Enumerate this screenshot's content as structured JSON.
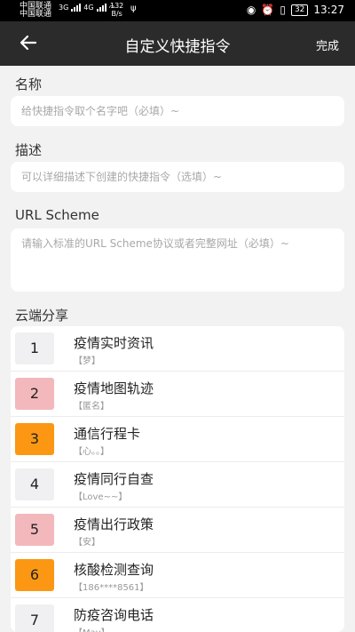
{
  "status_bar": {
    "carrier1": "中国联通",
    "carrier2": "中国联通",
    "net1": "3G",
    "net2": "4G",
    "speed_value": "132",
    "speed_unit": "B/s",
    "battery": "32",
    "time": "13:27"
  },
  "appbar": {
    "title": "自定义快捷指令",
    "done_label": "完成"
  },
  "form": {
    "name_label": "名称",
    "name_placeholder": "给快捷指令取个名字吧（必填）~",
    "name_value": "",
    "desc_label": "描述",
    "desc_placeholder": "可以详细描述下创建的快捷指令（选填）~",
    "desc_value": "",
    "url_label": "URL Scheme",
    "url_placeholder": "请输入标准的URL Scheme协议或者完整网址（必填）~",
    "url_value": ""
  },
  "cloud": {
    "section_label": "云端分享",
    "items": [
      {
        "rank": "1",
        "name": "疫情实时资讯",
        "author": "【梦】",
        "badge_color": "#f0f0f2"
      },
      {
        "rank": "2",
        "name": "疫情地图轨迹",
        "author": "【匿名】",
        "badge_color": "#f3b8bb"
      },
      {
        "rank": "3",
        "name": "通信行程卡",
        "author": "【心。。】",
        "badge_color": "#fb9712"
      },
      {
        "rank": "4",
        "name": "疫情同行自查",
        "author": "【Love~~】",
        "badge_color": "#f0f0f2"
      },
      {
        "rank": "5",
        "name": "疫情出行政策",
        "author": "【安】",
        "badge_color": "#f3b8bb"
      },
      {
        "rank": "6",
        "name": "核酸检测查询",
        "author": "【186****8561】",
        "badge_color": "#fb9712"
      },
      {
        "rank": "7",
        "name": "防疫咨询电话",
        "author": "【May】",
        "badge_color": "#f0f0f2"
      }
    ]
  },
  "colors": {
    "appbar_bg": "#2b2b2b",
    "page_bg": "#f2f2f2"
  }
}
